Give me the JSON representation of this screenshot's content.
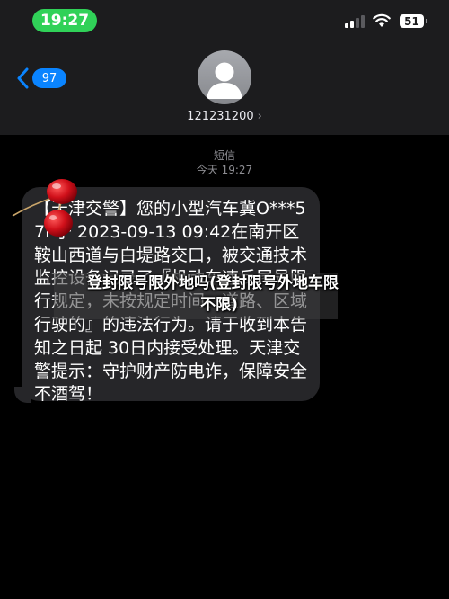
{
  "status_bar": {
    "time": "19:27",
    "battery": "51"
  },
  "nav": {
    "back_count": "97",
    "contact_name": "121231200"
  },
  "thread": {
    "service": "短信",
    "timestamp": "今天 19:27"
  },
  "message": {
    "text": "【天津交警】您的小型汽车冀O***57F于 2023-09-13 09:42在南开区鞍山西道与白堤路交口，被交通技术监控设备记录了『机动车违反尾号限行规定，未按规定时间、道路、区域行驶的』的违法行为。请于收到本告知之日起 30日内接受处理。天津交警提示：守护财产防电诈，保障安全不酒驾！"
  },
  "overlay": {
    "title_line1": "登封限号限外地吗(登封限号外地车限",
    "title_line2": "不限)"
  },
  "colors": {
    "header_bg": "#1c1c1e",
    "page_bg": "#000000",
    "bubble_bg": "#262629",
    "time_pill": "#30d158",
    "accent_blue": "#0a84ff"
  },
  "icons": [
    "signal-icon",
    "wifi-icon",
    "battery-icon",
    "back-chevron-icon",
    "avatar-person-icon",
    "chevron-right-icon",
    "cherry-sticker"
  ]
}
